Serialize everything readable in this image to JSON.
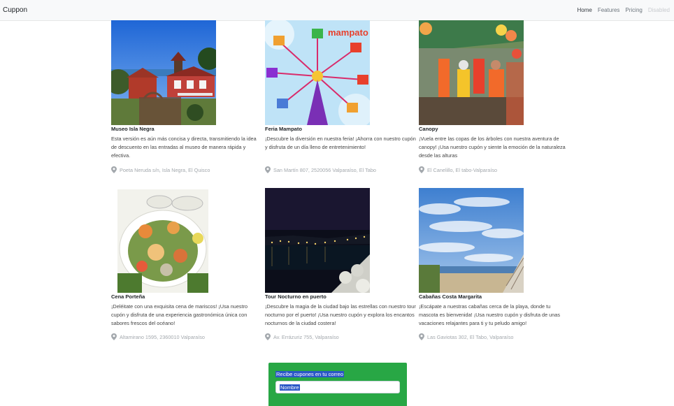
{
  "app": {
    "brand": "Cuppon"
  },
  "nav": {
    "home": "Home",
    "features": "Features",
    "pricing": "Pricing",
    "disabled": "Disabled"
  },
  "cards": [
    {
      "title": "Museo Isla Negra",
      "description": "Esta versión es aún más concisa y directa, transmitiendo la idea de descuento en las entradas al museo de manera rápida y efectiva.",
      "location": "Poeta Neruda s/n, Isla Negra, El Quisco"
    },
    {
      "title": "Feria Mampato",
      "description": "¡Descubre la diversión en nuestra feria! ¡Ahorra con nuestro cupón y disfruta de un día lleno de entretenimiento!",
      "location": "San Martín 807, 2520056 Valparaíso, El Tabo",
      "image_text": "mampato"
    },
    {
      "title": "Canopy",
      "description": "¡Vuela entre las copas de los árboles con nuestra aventura de canopy! ¡Usa nuestro cupón y siente la emoción de la naturaleza desde las alturas",
      "location": "El Canelillo, El tabo-Valparaíso"
    },
    {
      "title": "Cena Porteña",
      "description": "¡Deléitate con una exquisita cena de mariscos! ¡Usa nuestro cupón y disfruta de una experiencia gastronómica única con sabores frescos del océano!",
      "location": "Altamirano 1595, 2360010 Valparaíso"
    },
    {
      "title": "Tour Nocturno en puerto",
      "description": "¡Descubre la magia de la ciudad bajo las estrellas con nuestro tour nocturno por el puerto! ¡Usa nuestro cupón y explora los encantos nocturnos de la ciudad costera!",
      "location": "Av. Errázuriz 755, Valparaíso"
    },
    {
      "title": "Cabañas Costa Margarita",
      "description": "¡Escápate a nuestras cabañas cerca de la playa, donde tu mascota es bienvenida! ¡Usa nuestro cupón y disfruta de unas vacaciones relajantes para ti y tu peludo amigo!",
      "location": "Las Gaviotas 302, El Tabo, Valparaíso"
    }
  ],
  "subscribe": {
    "label": "Recibe cupones en tu correo",
    "name_placeholder": "Nombre"
  },
  "colors": {
    "accent_green": "#28a745",
    "selection_blue": "#2b57c7",
    "navbar_bg": "#f8f9fa"
  },
  "icons": {
    "location": "map-pin-icon"
  }
}
